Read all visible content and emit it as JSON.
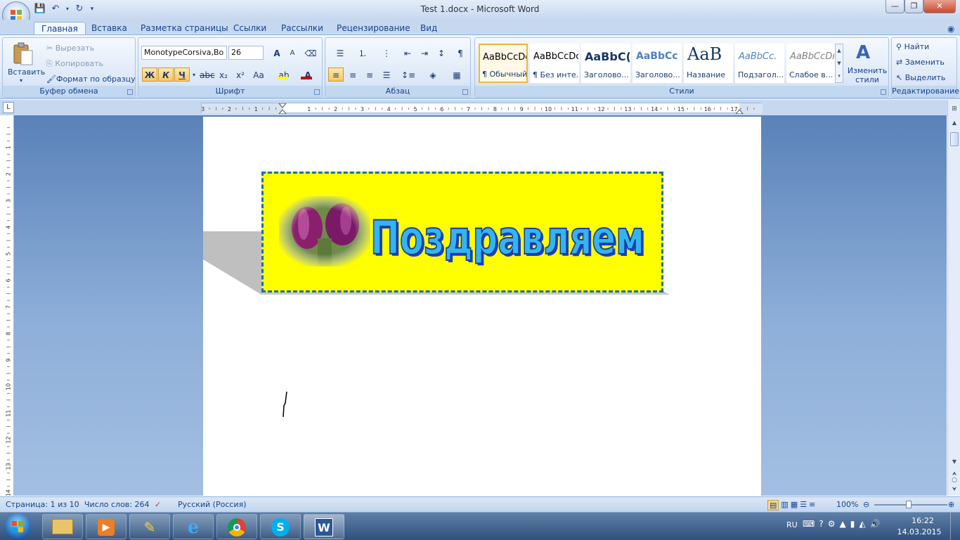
{
  "window": {
    "title": "Test 1.docx - Microsoft Word",
    "minimize": "—",
    "restore": "❐",
    "close": "✕"
  },
  "tabs": [
    {
      "label": "Главная"
    },
    {
      "label": "Вставка"
    },
    {
      "label": "Разметка страницы"
    },
    {
      "label": "Ссылки"
    },
    {
      "label": "Рассылки"
    },
    {
      "label": "Рецензирование"
    },
    {
      "label": "Вид"
    }
  ],
  "clipboard": {
    "paste": "Вставить",
    "cut": "Вырезать",
    "copy": "Копировать",
    "format_painter": "Формат по образцу",
    "label": "Буфер обмена"
  },
  "font": {
    "name": "MonotypeCorsiva,Bo",
    "size": "26",
    "bold": "Ж",
    "italic": "К",
    "underline": "Ч",
    "strike": "abc",
    "sub": "x₂",
    "sup": "x²",
    "case": "Aa",
    "grow": "A",
    "shrink": "A",
    "label": "Шрифт"
  },
  "paragraph": {
    "label": "Абзац"
  },
  "styles": {
    "label": "Стили",
    "items": [
      {
        "preview": "AaBbCcDc",
        "name": "¶ Обычный"
      },
      {
        "preview": "AaBbCcDc",
        "name": "¶ Без инте..."
      },
      {
        "preview": "AaBbC(",
        "name": "Заголово..."
      },
      {
        "preview": "AaBbCc",
        "name": "Заголово..."
      },
      {
        "preview": "AaB",
        "name": "Название"
      },
      {
        "preview": "AaBbCc.",
        "name": "Подзагол..."
      },
      {
        "preview": "AaBbCcDı",
        "name": "Слабое в..."
      }
    ],
    "change": "Изменить стили"
  },
  "editing": {
    "find": "Найти",
    "replace": "Заменить",
    "select": "Выделить",
    "label": "Редактирование"
  },
  "ruler": {
    "ticks": [
      "3",
      "2",
      "1",
      "1",
      "2",
      "3",
      "4",
      "5",
      "6",
      "7",
      "8",
      "9",
      "10",
      "11",
      "12",
      "13",
      "14",
      "15",
      "16",
      "17"
    ]
  },
  "vruler": {
    "ticks": [
      "1",
      "2",
      "3",
      "4",
      "5",
      "6",
      "7",
      "8",
      "9",
      "10",
      "11",
      "12",
      "13",
      "14"
    ]
  },
  "document": {
    "wordart": "Поздравляем"
  },
  "status": {
    "page": "Страница: 1 из 10",
    "words": "Число слов: 264",
    "language": "Русский (Россия)",
    "zoom": "100%"
  },
  "tray": {
    "lang": "RU",
    "time": "16:22",
    "date": "14.03.2015"
  }
}
